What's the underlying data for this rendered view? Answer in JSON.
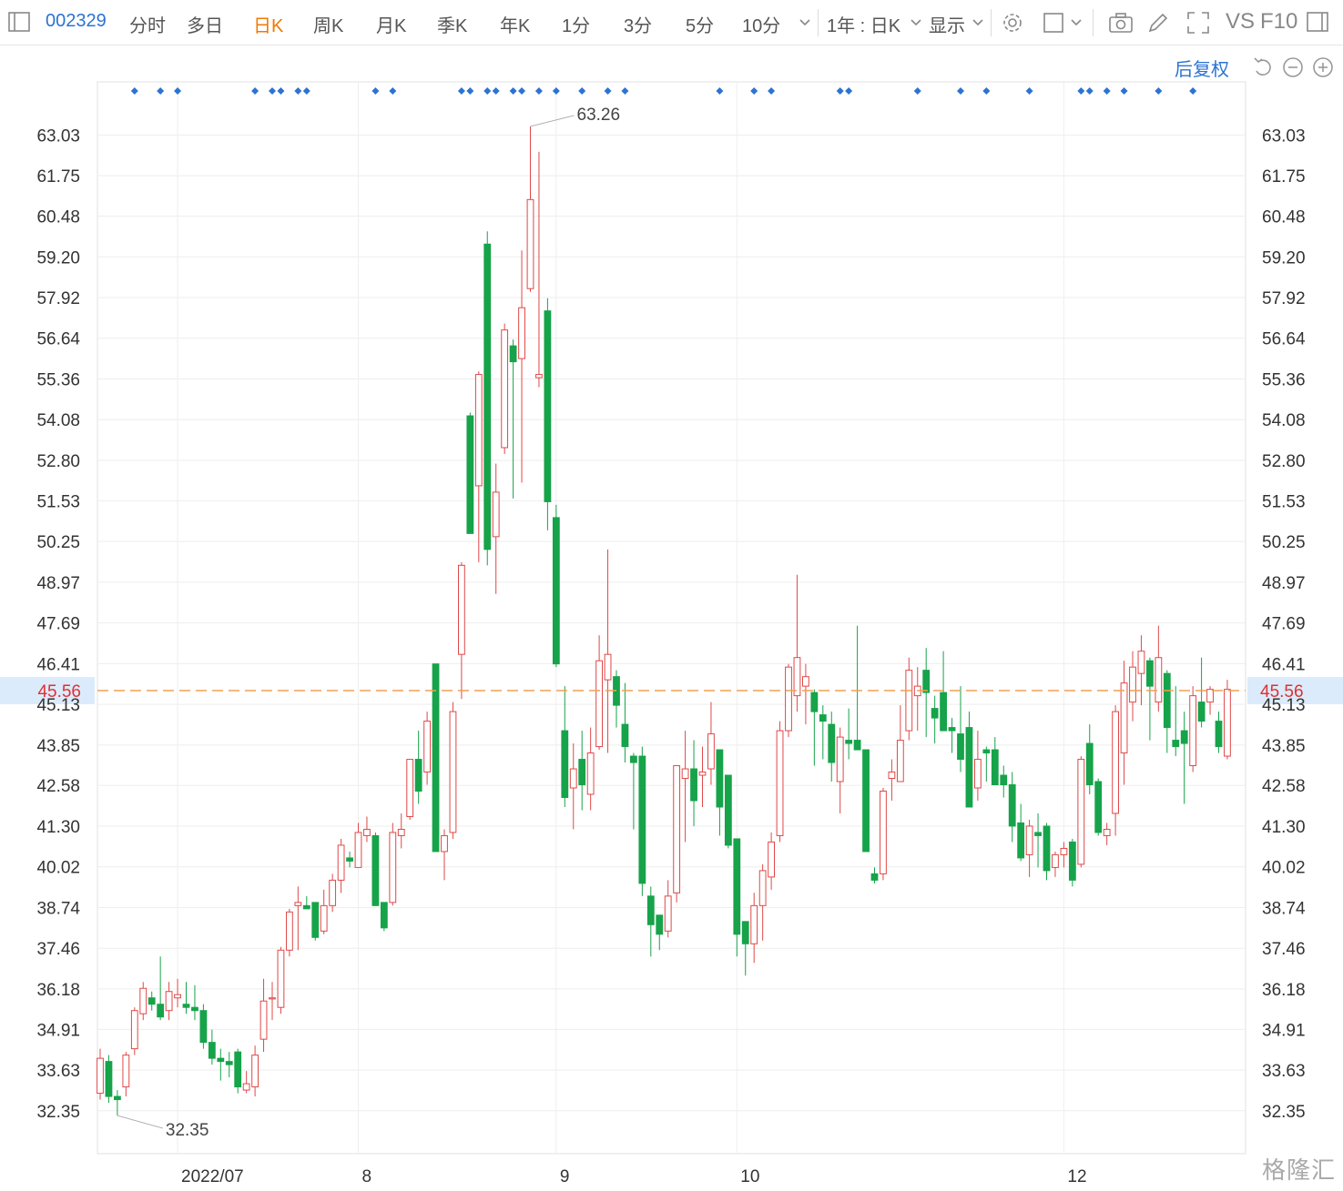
{
  "toolbar": {
    "stock_code": "002329",
    "tabs": [
      "分时",
      "多日",
      "日K",
      "周K",
      "月K",
      "季K",
      "年K",
      "1分",
      "3分",
      "5分",
      "10分"
    ],
    "active_tab": "日K",
    "range_label": "1年 : 日K",
    "display_label": "显示",
    "vs_label": "VS",
    "f10_label": "F10"
  },
  "header": {
    "adjust_label": "后复权"
  },
  "watermark": "格隆汇",
  "colors": {
    "up": "#e04848",
    "down": "#16a34a",
    "accent": "#2c73d2",
    "active_tab": "#f07800",
    "last_price_line": "#f0a050"
  },
  "chart_data": {
    "type": "candlestick",
    "y_ticks": [
      "63.03",
      "61.75",
      "60.48",
      "59.20",
      "57.92",
      "56.64",
      "55.36",
      "54.08",
      "52.80",
      "51.53",
      "50.25",
      "48.97",
      "47.69",
      "46.41",
      "45.13",
      "43.85",
      "42.58",
      "41.30",
      "40.02",
      "38.74",
      "37.46",
      "36.18",
      "34.91",
      "33.63",
      "32.35"
    ],
    "ylim": [
      31.0,
      64.7
    ],
    "x_labels": [
      {
        "label": "2022/07",
        "index": 9
      },
      {
        "label": "8",
        "index": 30
      },
      {
        "label": "9",
        "index": 53
      },
      {
        "label": "10",
        "index": 74
      },
      {
        "label": "12",
        "index": 112
      }
    ],
    "last_price": "45.56",
    "high_label": "63.26",
    "low_label": "32.35",
    "signal_marker_indices": [
      4,
      7,
      9,
      18,
      20,
      21,
      23,
      24,
      32,
      34,
      42,
      43,
      45,
      46,
      48,
      49,
      51,
      53,
      56,
      59,
      61,
      72,
      76,
      78,
      86,
      87,
      95,
      100,
      103,
      108,
      114,
      115,
      117,
      119,
      123,
      127
    ],
    "candles": [
      {
        "o": 32.9,
        "h": 34.3,
        "l": 32.7,
        "c": 34.0
      },
      {
        "o": 33.9,
        "h": 34.1,
        "l": 32.6,
        "c": 32.8
      },
      {
        "o": 32.8,
        "h": 33.0,
        "l": 32.2,
        "c": 32.7
      },
      {
        "o": 33.1,
        "h": 34.2,
        "l": 32.8,
        "c": 34.1
      },
      {
        "o": 34.3,
        "h": 35.6,
        "l": 34.1,
        "c": 35.5
      },
      {
        "o": 35.4,
        "h": 36.4,
        "l": 35.2,
        "c": 36.2
      },
      {
        "o": 35.9,
        "h": 36.1,
        "l": 35.5,
        "c": 35.7
      },
      {
        "o": 35.7,
        "h": 37.2,
        "l": 35.2,
        "c": 35.3
      },
      {
        "o": 35.5,
        "h": 36.4,
        "l": 35.2,
        "c": 36.1
      },
      {
        "o": 35.9,
        "h": 36.5,
        "l": 35.6,
        "c": 36.0
      },
      {
        "o": 35.7,
        "h": 36.4,
        "l": 35.4,
        "c": 35.6
      },
      {
        "o": 35.6,
        "h": 36.3,
        "l": 35.2,
        "c": 35.5
      },
      {
        "o": 35.5,
        "h": 35.7,
        "l": 34.3,
        "c": 34.5
      },
      {
        "o": 34.5,
        "h": 34.9,
        "l": 33.8,
        "c": 34.0
      },
      {
        "o": 34.0,
        "h": 34.3,
        "l": 33.3,
        "c": 33.9
      },
      {
        "o": 33.9,
        "h": 34.2,
        "l": 33.4,
        "c": 33.8
      },
      {
        "o": 34.2,
        "h": 34.3,
        "l": 32.9,
        "c": 33.1
      },
      {
        "o": 33.0,
        "h": 33.6,
        "l": 32.9,
        "c": 33.2
      },
      {
        "o": 33.1,
        "h": 34.4,
        "l": 32.8,
        "c": 34.1
      },
      {
        "o": 34.6,
        "h": 36.5,
        "l": 34.2,
        "c": 35.8
      },
      {
        "o": 35.9,
        "h": 36.4,
        "l": 35.2,
        "c": 35.9
      },
      {
        "o": 35.6,
        "h": 37.5,
        "l": 35.4,
        "c": 37.4
      },
      {
        "o": 37.4,
        "h": 38.7,
        "l": 37.2,
        "c": 38.6
      },
      {
        "o": 38.8,
        "h": 39.4,
        "l": 37.4,
        "c": 38.9
      },
      {
        "o": 38.8,
        "h": 39.1,
        "l": 38.7,
        "c": 38.7
      },
      {
        "o": 38.9,
        "h": 38.9,
        "l": 37.7,
        "c": 37.8
      },
      {
        "o": 38.0,
        "h": 39.3,
        "l": 37.9,
        "c": 38.8
      },
      {
        "o": 38.8,
        "h": 39.8,
        "l": 38.6,
        "c": 39.6
      },
      {
        "o": 39.6,
        "h": 40.9,
        "l": 39.2,
        "c": 40.7
      },
      {
        "o": 40.3,
        "h": 40.5,
        "l": 40.0,
        "c": 40.2
      },
      {
        "o": 40.0,
        "h": 41.4,
        "l": 40.0,
        "c": 41.1
      },
      {
        "o": 41.0,
        "h": 41.6,
        "l": 40.8,
        "c": 41.2
      },
      {
        "o": 41.0,
        "h": 41.1,
        "l": 38.8,
        "c": 38.8
      },
      {
        "o": 38.9,
        "h": 38.9,
        "l": 38.0,
        "c": 38.1
      },
      {
        "o": 38.9,
        "h": 41.4,
        "l": 38.8,
        "c": 41.1
      },
      {
        "o": 41.0,
        "h": 41.7,
        "l": 40.6,
        "c": 41.2
      },
      {
        "o": 41.6,
        "h": 43.3,
        "l": 41.5,
        "c": 43.4
      },
      {
        "o": 43.4,
        "h": 44.3,
        "l": 42.0,
        "c": 42.4
      },
      {
        "o": 43.0,
        "h": 44.9,
        "l": 42.6,
        "c": 44.6
      },
      {
        "o": 46.4,
        "h": 46.4,
        "l": 40.5,
        "c": 40.5
      },
      {
        "o": 40.5,
        "h": 41.2,
        "l": 39.6,
        "c": 41.0
      },
      {
        "o": 41.1,
        "h": 45.2,
        "l": 40.9,
        "c": 44.9
      },
      {
        "o": 46.7,
        "h": 49.6,
        "l": 45.3,
        "c": 49.5
      },
      {
        "o": 54.2,
        "h": 54.3,
        "l": 51.3,
        "c": 50.5
      },
      {
        "o": 52.0,
        "h": 55.6,
        "l": 49.6,
        "c": 55.5
      },
      {
        "o": 59.6,
        "h": 60.0,
        "l": 49.5,
        "c": 50.0
      },
      {
        "o": 50.4,
        "h": 52.7,
        "l": 48.6,
        "c": 51.8
      },
      {
        "o": 53.2,
        "h": 57.1,
        "l": 53.0,
        "c": 56.9
      },
      {
        "o": 56.4,
        "h": 56.6,
        "l": 51.6,
        "c": 55.9
      },
      {
        "o": 56.0,
        "h": 59.4,
        "l": 52.1,
        "c": 57.6
      },
      {
        "o": 58.2,
        "h": 63.3,
        "l": 58.1,
        "c": 61.0
      },
      {
        "o": 55.4,
        "h": 62.5,
        "l": 55.1,
        "c": 55.5
      },
      {
        "o": 57.5,
        "h": 57.9,
        "l": 50.6,
        "c": 51.5
      },
      {
        "o": 51.0,
        "h": 51.4,
        "l": 46.3,
        "c": 46.4
      },
      {
        "o": 44.3,
        "h": 45.7,
        "l": 41.9,
        "c": 42.2
      },
      {
        "o": 42.5,
        "h": 43.9,
        "l": 41.2,
        "c": 43.1
      },
      {
        "o": 43.4,
        "h": 44.3,
        "l": 41.8,
        "c": 42.6
      },
      {
        "o": 42.3,
        "h": 44.4,
        "l": 41.8,
        "c": 43.6
      },
      {
        "o": 43.8,
        "h": 47.3,
        "l": 43.7,
        "c": 46.5
      },
      {
        "o": 45.9,
        "h": 50.0,
        "l": 43.6,
        "c": 46.7
      },
      {
        "o": 46.0,
        "h": 46.2,
        "l": 44.4,
        "c": 45.1
      },
      {
        "o": 44.5,
        "h": 45.8,
        "l": 43.3,
        "c": 43.8
      },
      {
        "o": 43.5,
        "h": 43.6,
        "l": 41.2,
        "c": 43.3
      },
      {
        "o": 43.5,
        "h": 43.8,
        "l": 39.1,
        "c": 39.5
      },
      {
        "o": 39.1,
        "h": 39.4,
        "l": 37.2,
        "c": 38.2
      },
      {
        "o": 38.5,
        "h": 38.5,
        "l": 37.4,
        "c": 37.9
      },
      {
        "o": 38.0,
        "h": 39.6,
        "l": 37.8,
        "c": 39.1
      },
      {
        "o": 39.2,
        "h": 43.1,
        "l": 38.9,
        "c": 43.2
      },
      {
        "o": 42.8,
        "h": 44.3,
        "l": 40.8,
        "c": 43.1
      },
      {
        "o": 43.1,
        "h": 44.0,
        "l": 41.3,
        "c": 42.1
      },
      {
        "o": 42.9,
        "h": 43.8,
        "l": 41.9,
        "c": 43.0
      },
      {
        "o": 43.1,
        "h": 45.2,
        "l": 42.6,
        "c": 44.2
      },
      {
        "o": 43.7,
        "h": 43.7,
        "l": 41.0,
        "c": 41.9
      },
      {
        "o": 42.9,
        "h": 42.9,
        "l": 40.6,
        "c": 40.7
      },
      {
        "o": 40.9,
        "h": 40.9,
        "l": 37.2,
        "c": 37.9
      },
      {
        "o": 38.3,
        "h": 38.3,
        "l": 36.6,
        "c": 37.6
      },
      {
        "o": 37.6,
        "h": 39.2,
        "l": 37.0,
        "c": 38.8
      },
      {
        "o": 38.8,
        "h": 40.1,
        "l": 37.7,
        "c": 39.9
      },
      {
        "o": 39.7,
        "h": 41.1,
        "l": 39.3,
        "c": 40.8
      },
      {
        "o": 41.0,
        "h": 44.6,
        "l": 40.8,
        "c": 44.3
      },
      {
        "o": 44.3,
        "h": 46.4,
        "l": 44.1,
        "c": 46.3
      },
      {
        "o": 45.4,
        "h": 49.2,
        "l": 44.9,
        "c": 46.6
      },
      {
        "o": 45.7,
        "h": 46.4,
        "l": 44.5,
        "c": 46.0
      },
      {
        "o": 45.5,
        "h": 45.6,
        "l": 43.2,
        "c": 44.9
      },
      {
        "o": 44.8,
        "h": 45.1,
        "l": 43.4,
        "c": 44.6
      },
      {
        "o": 44.5,
        "h": 44.9,
        "l": 42.7,
        "c": 43.3
      },
      {
        "o": 42.7,
        "h": 44.4,
        "l": 41.7,
        "c": 44.1
      },
      {
        "o": 44.0,
        "h": 45.0,
        "l": 43.4,
        "c": 43.9
      },
      {
        "o": 44.0,
        "h": 47.6,
        "l": 43.7,
        "c": 43.7
      },
      {
        "o": 43.7,
        "h": 43.7,
        "l": 40.5,
        "c": 40.5
      },
      {
        "o": 39.8,
        "h": 40.0,
        "l": 39.5,
        "c": 39.6
      },
      {
        "o": 39.8,
        "h": 42.5,
        "l": 39.6,
        "c": 42.4
      },
      {
        "o": 42.8,
        "h": 43.4,
        "l": 42.1,
        "c": 43.0
      },
      {
        "o": 42.7,
        "h": 45.1,
        "l": 42.7,
        "c": 44.0
      },
      {
        "o": 44.3,
        "h": 46.6,
        "l": 44.0,
        "c": 46.2
      },
      {
        "o": 45.4,
        "h": 46.3,
        "l": 44.3,
        "c": 45.7
      },
      {
        "o": 46.2,
        "h": 46.9,
        "l": 44.1,
        "c": 45.5
      },
      {
        "o": 45.0,
        "h": 45.4,
        "l": 43.9,
        "c": 44.7
      },
      {
        "o": 45.5,
        "h": 46.8,
        "l": 44.5,
        "c": 44.3
      },
      {
        "o": 44.4,
        "h": 44.7,
        "l": 43.6,
        "c": 44.3
      },
      {
        "o": 44.2,
        "h": 45.7,
        "l": 43.0,
        "c": 43.4
      },
      {
        "o": 44.4,
        "h": 44.9,
        "l": 41.9,
        "c": 41.9
      },
      {
        "o": 42.5,
        "h": 44.3,
        "l": 42.1,
        "c": 43.4
      },
      {
        "o": 43.7,
        "h": 43.8,
        "l": 42.7,
        "c": 43.6
      },
      {
        "o": 43.7,
        "h": 44.1,
        "l": 42.6,
        "c": 42.6
      },
      {
        "o": 42.9,
        "h": 43.2,
        "l": 42.2,
        "c": 42.6
      },
      {
        "o": 42.6,
        "h": 43.0,
        "l": 40.8,
        "c": 41.3
      },
      {
        "o": 41.4,
        "h": 42.0,
        "l": 40.2,
        "c": 40.3
      },
      {
        "o": 40.4,
        "h": 41.5,
        "l": 39.7,
        "c": 41.3
      },
      {
        "o": 41.1,
        "h": 41.7,
        "l": 40.0,
        "c": 41.0
      },
      {
        "o": 41.3,
        "h": 41.4,
        "l": 39.6,
        "c": 39.9
      },
      {
        "o": 40.0,
        "h": 40.5,
        "l": 39.7,
        "c": 40.4
      },
      {
        "o": 40.4,
        "h": 40.8,
        "l": 40.0,
        "c": 40.6
      },
      {
        "o": 40.8,
        "h": 40.9,
        "l": 39.4,
        "c": 39.6
      },
      {
        "o": 40.1,
        "h": 43.5,
        "l": 40.0,
        "c": 43.4
      },
      {
        "o": 43.9,
        "h": 44.5,
        "l": 42.3,
        "c": 42.6
      },
      {
        "o": 42.7,
        "h": 42.8,
        "l": 41.0,
        "c": 41.1
      },
      {
        "o": 41.0,
        "h": 41.4,
        "l": 40.7,
        "c": 41.2
      },
      {
        "o": 41.7,
        "h": 45.1,
        "l": 41.0,
        "c": 44.9
      },
      {
        "o": 43.6,
        "h": 46.5,
        "l": 42.6,
        "c": 45.8
      },
      {
        "o": 45.2,
        "h": 46.8,
        "l": 44.6,
        "c": 46.3
      },
      {
        "o": 46.1,
        "h": 47.3,
        "l": 45.1,
        "c": 46.8
      },
      {
        "o": 46.5,
        "h": 46.6,
        "l": 44.0,
        "c": 45.7
      },
      {
        "o": 45.2,
        "h": 47.6,
        "l": 44.9,
        "c": 46.6
      },
      {
        "o": 46.1,
        "h": 46.2,
        "l": 43.6,
        "c": 44.4
      },
      {
        "o": 44.0,
        "h": 45.7,
        "l": 43.5,
        "c": 43.8
      },
      {
        "o": 44.3,
        "h": 44.9,
        "l": 42.0,
        "c": 43.9
      },
      {
        "o": 43.2,
        "h": 45.7,
        "l": 43.0,
        "c": 45.4
      },
      {
        "o": 45.2,
        "h": 46.6,
        "l": 44.4,
        "c": 44.6
      },
      {
        "o": 45.2,
        "h": 45.7,
        "l": 44.8,
        "c": 45.6
      },
      {
        "o": 44.6,
        "h": 44.9,
        "l": 43.6,
        "c": 43.8
      },
      {
        "o": 43.5,
        "h": 45.9,
        "l": 43.4,
        "c": 45.6
      }
    ]
  }
}
